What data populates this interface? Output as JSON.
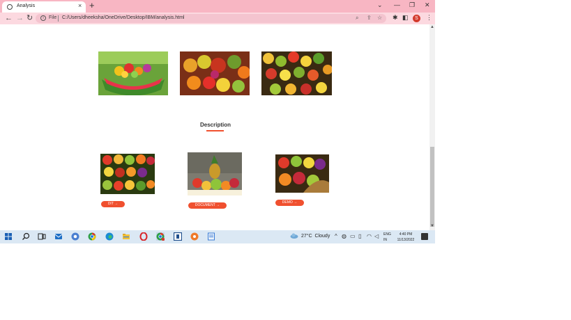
{
  "browser": {
    "tab_title": "Analysis",
    "scheme_label": "File",
    "url": "C:/Users/dheeksha/OneDrive/Desktop/IBM/analysis.html",
    "profile_initial": "S"
  },
  "page": {
    "description_heading": "Description",
    "buttons": {
      "dit": "DIT →",
      "document": "DOCUMENT →",
      "demo": "DEMO →"
    },
    "accent_color": "#f0502f"
  },
  "taskbar": {
    "temperature": "27°C",
    "weather": "Cloudy",
    "lang_line1": "ENG",
    "lang_line2": "IN",
    "time": "4:40 PM",
    "date": "11/13/2022"
  }
}
